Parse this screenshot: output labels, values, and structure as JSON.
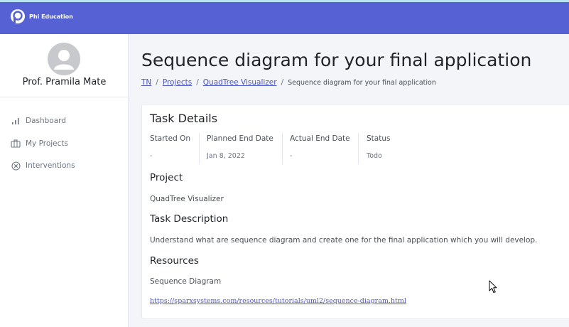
{
  "app": {
    "brand": "Phi Education"
  },
  "sidebar": {
    "profile_name": "Prof. Pramila Mate",
    "items": [
      {
        "label": "Dashboard",
        "icon": "bar-chart-icon"
      },
      {
        "label": "My Projects",
        "icon": "briefcase-icon"
      },
      {
        "label": "Interventions",
        "icon": "circle-x-icon"
      }
    ]
  },
  "main": {
    "title": "Sequence diagram for your final application",
    "breadcrumb": {
      "items": [
        "TN",
        "Projects",
        "QuadTree Visualizer"
      ],
      "separator": "/",
      "current": "Sequence diagram for your final application"
    }
  },
  "task": {
    "heading": "Task Details",
    "fields": [
      {
        "label": "Started On",
        "value": "-"
      },
      {
        "label": "Planned End Date",
        "value": "Jan 8, 2022"
      },
      {
        "label": "Actual End Date",
        "value": "-"
      },
      {
        "label": "Status",
        "value": "Todo"
      }
    ],
    "project_heading": "Project",
    "project": "QuadTree Visualizer",
    "description_heading": "Task Description",
    "description": "Understand what are sequence diagram and create one for the final application which you will develop.",
    "resources_heading": "Resources",
    "resource_name": "Sequence Diagram",
    "resource_link": "https://sparxsystems.com/resources/tutorials/uml2/sequence-diagram.html"
  },
  "colors": {
    "topbar": "#5662d3",
    "accent_link": "#4a54c6",
    "page_background": "#f3f5f9"
  }
}
